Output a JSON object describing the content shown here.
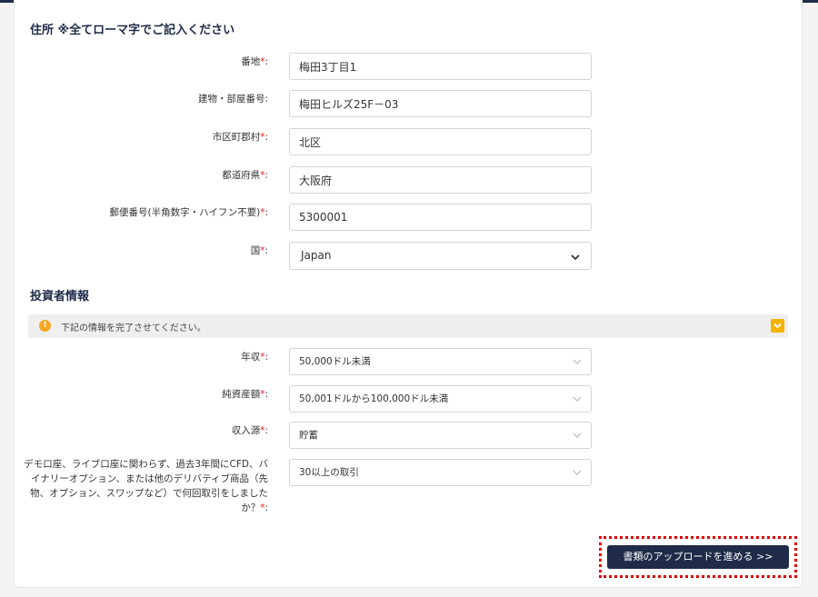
{
  "address_section": {
    "title": "住所 ※全てローマ字でご記入ください",
    "fields": [
      {
        "label": "番地",
        "required": true,
        "value": "梅田3丁目1"
      },
      {
        "label": "建物・部屋番号",
        "required": false,
        "value": "梅田ヒルズ25F－03"
      },
      {
        "label": "市区町郡村",
        "required": true,
        "value": "北区"
      },
      {
        "label": "都道府県",
        "required": true,
        "value": "大阪府"
      },
      {
        "label": "郵便番号(半角数字・ハイフン不要)",
        "required": true,
        "value": "5300001"
      }
    ],
    "country": {
      "label": "国",
      "required": true,
      "value": "Japan"
    }
  },
  "investor_section": {
    "title": "投資者情報",
    "notice": "下記の情報を完了させてください。",
    "selects": [
      {
        "label": "年収",
        "required": true,
        "value": "50,000ドル未満"
      },
      {
        "label": "純資産額",
        "required": true,
        "value": "50,001ドルから100,000ドル未満"
      },
      {
        "label": "収入源",
        "required": true,
        "value": "貯蓄"
      }
    ],
    "trading_question": {
      "label": "デモ口座、ライブ口座に関わらず、過去3年間にCFD、バイナリーオプション、または他のデリバティブ商品（先物、オプション、スワップなど）で何回取引をしましたか？",
      "required": true,
      "value": "30以上の取引"
    }
  },
  "actions": {
    "proceed_label": "書類のアップロードを進める >>"
  },
  "colors": {
    "navy": "#1f2b48",
    "required": "#e02020",
    "notice_icon": "#f5a623",
    "highlight": "#e00000"
  }
}
